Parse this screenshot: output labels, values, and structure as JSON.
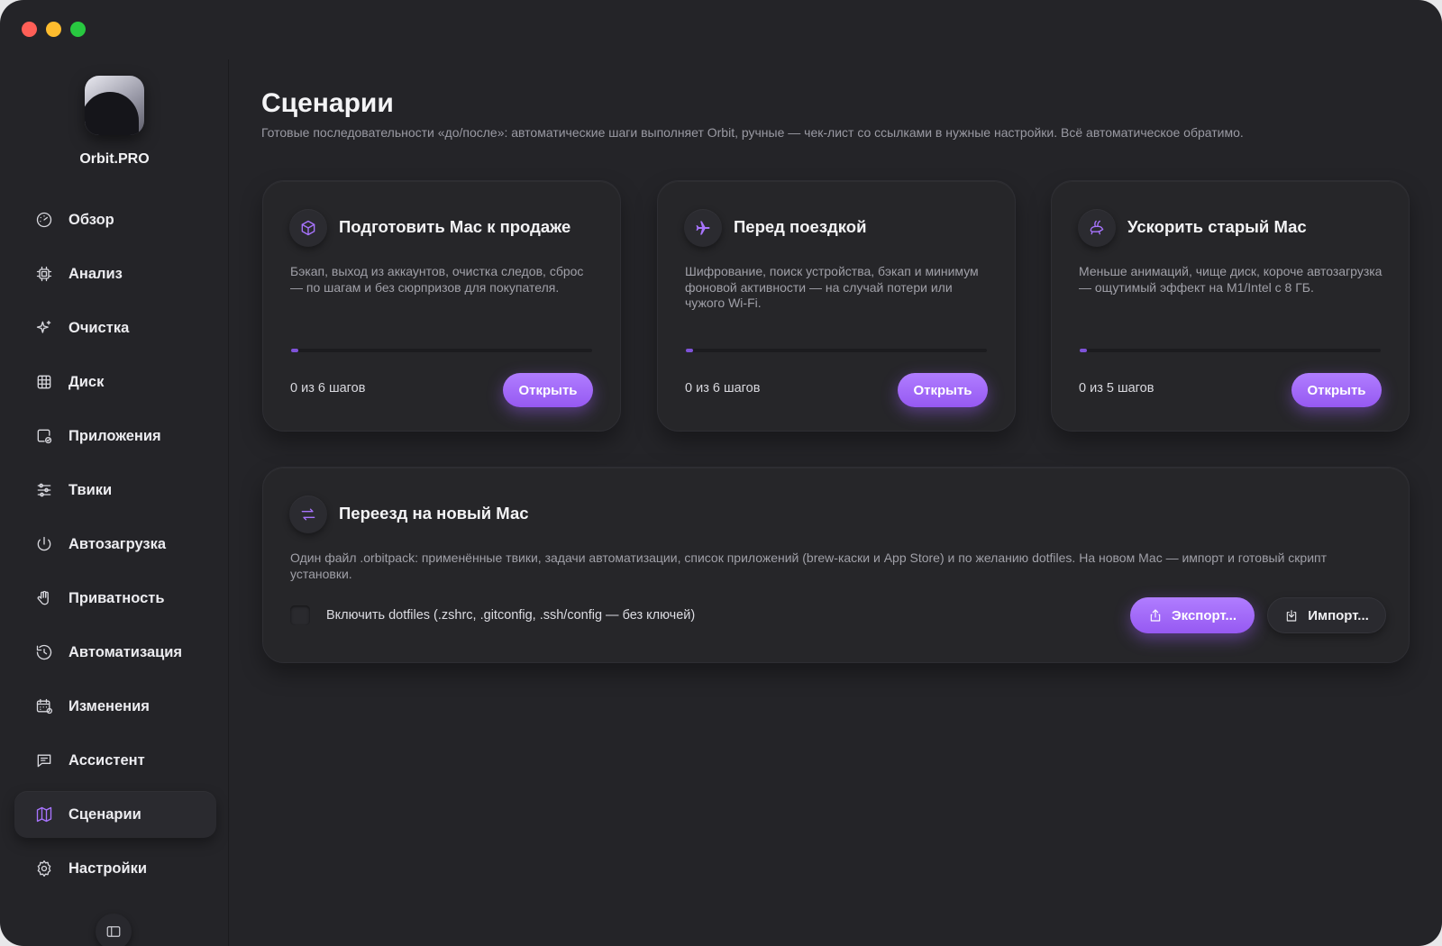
{
  "app": {
    "name": "Orbit.PRO"
  },
  "sidebar": {
    "items": [
      {
        "label": "Обзор",
        "icon": "gauge-icon"
      },
      {
        "label": "Анализ",
        "icon": "cpu-icon"
      },
      {
        "label": "Очистка",
        "icon": "sparkle-icon"
      },
      {
        "label": "Диск",
        "icon": "grid-icon"
      },
      {
        "label": "Приложения",
        "icon": "app-check-icon"
      },
      {
        "label": "Твики",
        "icon": "sliders-icon"
      },
      {
        "label": "Автозагрузка",
        "icon": "power-icon"
      },
      {
        "label": "Приватность",
        "icon": "hand-icon"
      },
      {
        "label": "Автоматизация",
        "icon": "history-icon"
      },
      {
        "label": "Изменения",
        "icon": "calendar-icon"
      },
      {
        "label": "Ассистент",
        "icon": "chat-icon"
      },
      {
        "label": "Сценарии",
        "icon": "map-icon",
        "active": true
      },
      {
        "label": "Настройки",
        "icon": "gear-icon"
      }
    ]
  },
  "main": {
    "title": "Сценарии",
    "subtitle": "Готовые последовательности «до/после»: автоматические шаги выполняет Orbit, ручные — чек-лист со ссылками в нужные настройки. Всё автоматическое обратимо.",
    "scenarios": [
      {
        "title": "Подготовить Мас к продаже",
        "description": "Бэкап, выход из аккаунтов, очистка следов, сброс — по шагам и без сюрпризов для покупателя.",
        "steps": "0 из 6 шагов",
        "progress": 0,
        "button": "Открыть",
        "icon": "box-icon"
      },
      {
        "title": "Перед поездкой",
        "description": "Шифрование, поиск устройства, бэкап и минимум фоновой активности — на случай потери или чужого Wi-Fi.",
        "steps": "0 из 6 шагов",
        "progress": 0,
        "button": "Открыть",
        "icon": "airplane-icon"
      },
      {
        "title": "Ускорить старый Мас",
        "description": "Меньше анимаций, чище диск, короче автозагрузка — ощутимый эффект на M1/Intel с 8 ГБ.",
        "steps": "0 из 5 шагов",
        "progress": 0,
        "button": "Открыть",
        "icon": "rabbit-icon"
      }
    ],
    "migration": {
      "title": "Переезд на новый Мас",
      "description": "Один файл .orbitpack: применённые твики, задачи автоматизации, список приложений (brew-каски и App Store) и по желанию dotfiles. На новом Мас — импорт и готовый скрипт установки.",
      "checkbox_label": "Включить dotfiles (.zshrc, .gitconfig, .ssh/config — без ключей)",
      "checkbox_checked": false,
      "export_label": "Экспорт...",
      "import_label": "Импорт...",
      "icon": "swap-arrows-icon"
    }
  },
  "colors": {
    "accent": "#a874ff",
    "background": "#242428",
    "card": "#262629"
  }
}
